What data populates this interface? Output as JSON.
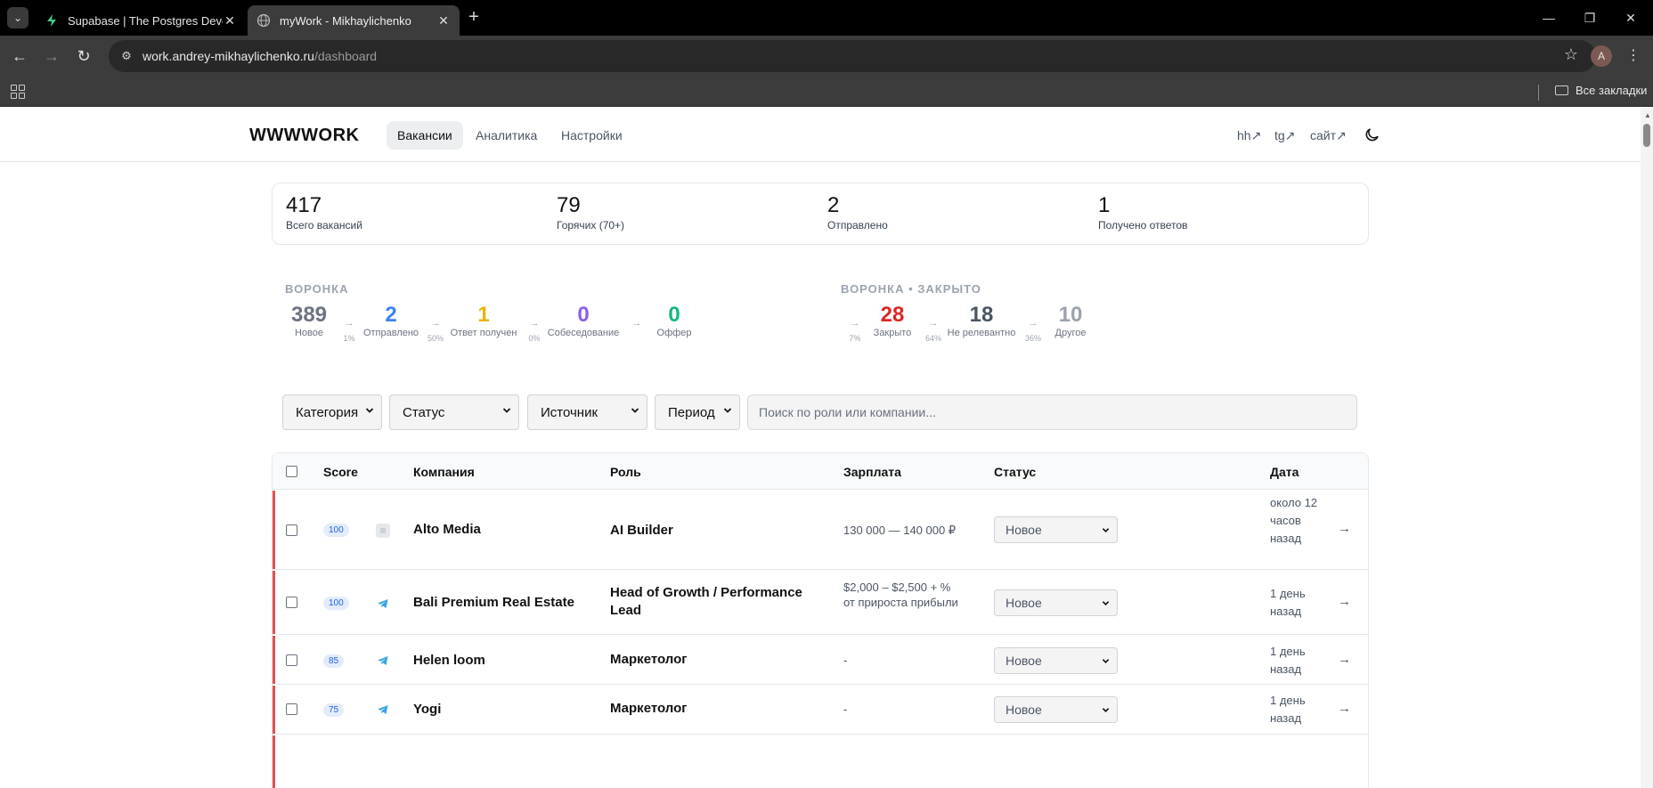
{
  "browser": {
    "tabs": [
      {
        "title": "Supabase | The Postgres Develo",
        "active": false
      },
      {
        "title": "myWork - Mikhaylichenko",
        "active": true
      }
    ],
    "url_host": "work.andrey-mikhaylichenko.ru",
    "url_path": "/dashboard",
    "profile_initial": "A",
    "bookmarks_all": "Все закладки"
  },
  "app": {
    "brand": "WWWWORK",
    "nav": [
      "Вакансии",
      "Аналитика",
      "Настройки"
    ],
    "links": [
      "hh↗",
      "tg↗",
      "сайт↗"
    ]
  },
  "stats": [
    {
      "value": "417",
      "label": "Всего вакансий"
    },
    {
      "value": "79",
      "label": "Горячих (70+)"
    },
    {
      "value": "2",
      "label": "Отправлено"
    },
    {
      "value": "1",
      "label": "Получено ответов"
    }
  ],
  "funnel": {
    "title": "ВОРОНКА",
    "steps": [
      {
        "value": "389",
        "label": "Новое",
        "color": "#6b7280"
      },
      {
        "value": "2",
        "label": "Отправлено",
        "color": "#3b82f6"
      },
      {
        "value": "1",
        "label": "Ответ получен",
        "color": "#eab308"
      },
      {
        "value": "0",
        "label": "Собеседование",
        "color": "#8b5cf6"
      },
      {
        "value": "0",
        "label": "Оффер",
        "color": "#10b981"
      }
    ],
    "arrows": [
      "1%",
      "50%",
      "0%",
      ""
    ]
  },
  "funnel_closed": {
    "title": "ВОРОНКА • ЗАКРЫТО",
    "lead_arrow": "7%",
    "steps": [
      {
        "value": "28",
        "label": "Закрыто",
        "color": "#dc2626"
      },
      {
        "value": "18",
        "label": "Не релевантно",
        "color": "#4b5563"
      },
      {
        "value": "10",
        "label": "Другое",
        "color": "#9ca3af"
      }
    ],
    "arrows": [
      "64%",
      "36%"
    ]
  },
  "filters": {
    "category": "Категория",
    "status": "Статус",
    "source": "Источник",
    "period": "Период",
    "search_placeholder": "Поиск по роли или компании..."
  },
  "table": {
    "headers": {
      "score": "Score",
      "company": "Компания",
      "role": "Роль",
      "salary": "Зарплата",
      "status": "Статус",
      "date": "Дата"
    },
    "rows": [
      {
        "score": "100",
        "source": "hh-icon",
        "company": "Alto Media",
        "role": "AI Builder",
        "salary": "130 000 — 140 000 ₽",
        "status": "Новое",
        "date": "около 12 часов назад"
      },
      {
        "score": "100",
        "source": "telegram-icon",
        "company": "Bali Premium Real Estate",
        "role": "Head of Growth / Performance Lead",
        "salary": "$2,000 – $2,500 + % от прироста прибыли",
        "status": "Новое",
        "date": "1 день назад"
      },
      {
        "score": "85",
        "source": "telegram-icon",
        "company": "Helen loom",
        "role": "Маркетолог",
        "salary": "-",
        "status": "Новое",
        "date": "1 день назад"
      },
      {
        "score": "75",
        "source": "telegram-icon",
        "company": "Yogi",
        "role": "Маркетолог",
        "salary": "-",
        "status": "Новое",
        "date": "1 день назад"
      }
    ]
  }
}
